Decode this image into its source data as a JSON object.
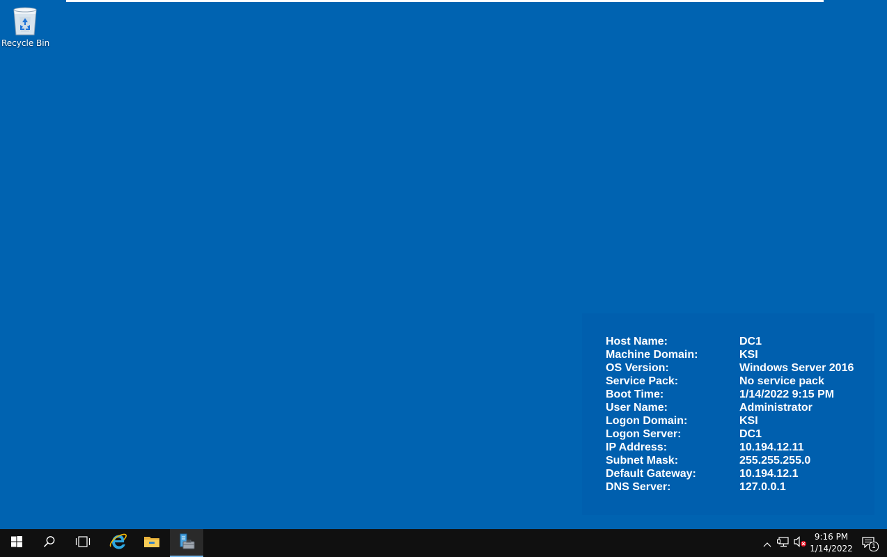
{
  "desktop": {
    "icons": [
      {
        "label": "Recycle Bin",
        "icon": "recycle-bin-icon"
      }
    ]
  },
  "bginfo": {
    "rows": [
      {
        "key": "Host Name:",
        "value": "DC1"
      },
      {
        "key": "Machine Domain:",
        "value": "KSI"
      },
      {
        "key": "OS Version:",
        "value": "Windows Server 2016"
      },
      {
        "key": "Service Pack:",
        "value": "No service pack"
      },
      {
        "key": "Boot Time:",
        "value": "1/14/2022 9:15 PM"
      },
      {
        "key": "User Name:",
        "value": "Administrator"
      },
      {
        "key": "Logon Domain:",
        "value": "KSI"
      },
      {
        "key": "Logon Server:",
        "value": "DC1"
      },
      {
        "key": "IP Address:",
        "value": "10.194.12.11"
      },
      {
        "key": "Subnet Mask:",
        "value": "255.255.255.0"
      },
      {
        "key": "Default Gateway:",
        "value": "10.194.12.1"
      },
      {
        "key": "DNS Server:",
        "value": "127.0.0.1"
      }
    ]
  },
  "taskbar": {
    "buttons": [
      {
        "name": "start-button",
        "icon": "windows-logo-icon"
      },
      {
        "name": "search-button",
        "icon": "search-icon"
      },
      {
        "name": "task-view-button",
        "icon": "task-view-icon"
      },
      {
        "name": "internet-explorer-button",
        "icon": "internet-explorer-icon"
      },
      {
        "name": "file-explorer-button",
        "icon": "folder-icon"
      },
      {
        "name": "server-manager-button",
        "icon": "server-manager-icon",
        "active": true
      }
    ],
    "tray": {
      "icons": [
        "chevron-up-icon",
        "network-icon",
        "volume-muted-icon"
      ],
      "time": "9:16 PM",
      "date": "1/14/2022",
      "notification_count": "1"
    }
  },
  "colors": {
    "desktop_bg": "#0063b1",
    "taskbar_bg": "#101010",
    "accent": "#76b9ed"
  }
}
